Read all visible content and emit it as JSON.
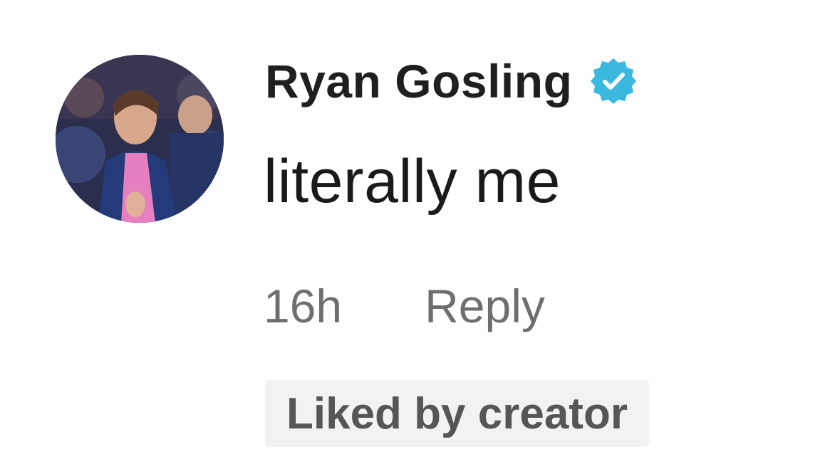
{
  "comment": {
    "author": {
      "name": "Ryan Gosling",
      "verified_icon": "verified-badge-icon",
      "avatar_icon": "profile-photo"
    },
    "text": "literally me",
    "timestamp": "16h",
    "reply_label": "Reply",
    "liked_badge": "Liked by creator"
  },
  "colors": {
    "verified_blue": "#3bb8e0",
    "meta_gray": "#6e6e6e",
    "badge_bg": "#f2f2f4"
  }
}
